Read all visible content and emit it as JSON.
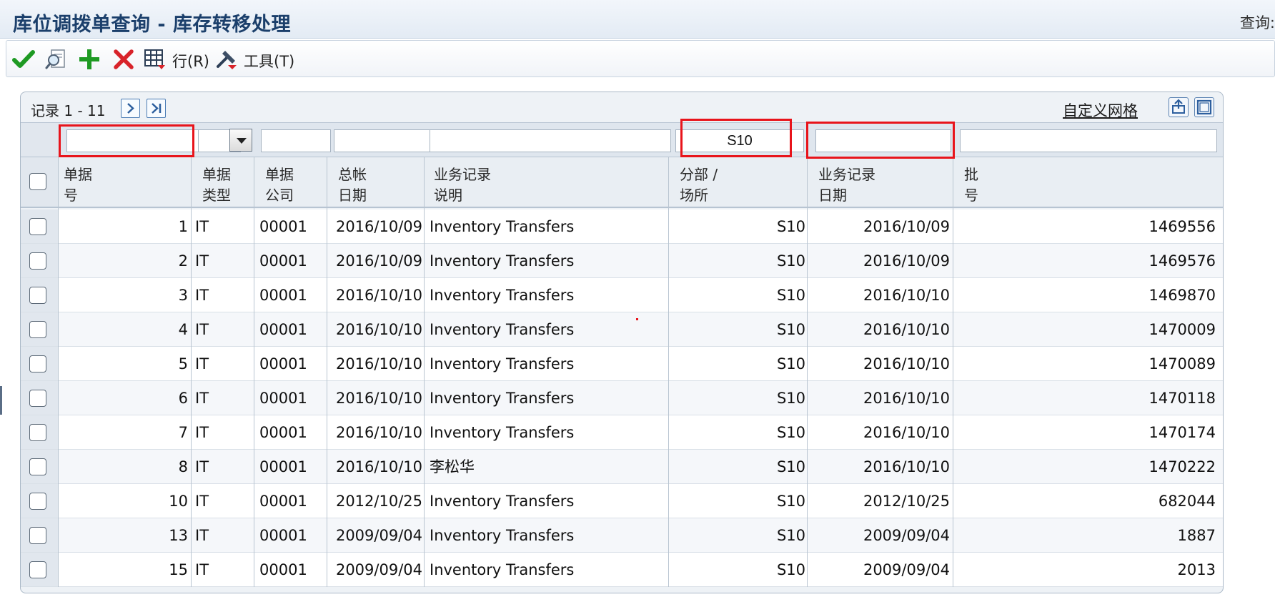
{
  "window": {
    "title": "库位调拨单查询 - 库存转移处理",
    "query_label": "查询:"
  },
  "toolbar": {
    "ok_icon": "checkmark-icon",
    "find_icon": "search-document-icon",
    "add_icon": "plus-icon",
    "delete_icon": "x-icon",
    "row_label": "行(R)",
    "tools_label": "工具(T)"
  },
  "grid": {
    "records_label": "记录 1 - 11",
    "customize_label": "自定义网格",
    "filters": {
      "doc_no": "",
      "doc_type": "",
      "doc_company": "",
      "gl_date": "",
      "explanation": "",
      "branch_plant": "S10",
      "transaction_date": "",
      "lot_no": ""
    },
    "columns": {
      "doc_no": "单据\n号",
      "doc_type": "单据\n类型",
      "doc_company": "单据\n公司",
      "gl_date": "总帐\n日期",
      "explanation": "业务记录\n说明",
      "branch_plant": "分部 /\n场所",
      "transaction_date": "业务记录\n日期",
      "lot_no": "批\n号"
    },
    "rows": [
      {
        "doc_no": "1",
        "doc_type": "IT",
        "company": "00001",
        "gl_date": "2016/10/09",
        "explanation": "Inventory Transfers",
        "branch": "S10",
        "trans_date": "2016/10/09",
        "lot": "1469556"
      },
      {
        "doc_no": "2",
        "doc_type": "IT",
        "company": "00001",
        "gl_date": "2016/10/09",
        "explanation": "Inventory Transfers",
        "branch": "S10",
        "trans_date": "2016/10/09",
        "lot": "1469576"
      },
      {
        "doc_no": "3",
        "doc_type": "IT",
        "company": "00001",
        "gl_date": "2016/10/10",
        "explanation": "Inventory Transfers",
        "branch": "S10",
        "trans_date": "2016/10/10",
        "lot": "1469870"
      },
      {
        "doc_no": "4",
        "doc_type": "IT",
        "company": "00001",
        "gl_date": "2016/10/10",
        "explanation": "Inventory Transfers",
        "branch": "S10",
        "trans_date": "2016/10/10",
        "lot": "1470009"
      },
      {
        "doc_no": "5",
        "doc_type": "IT",
        "company": "00001",
        "gl_date": "2016/10/10",
        "explanation": "Inventory Transfers",
        "branch": "S10",
        "trans_date": "2016/10/10",
        "lot": "1470089"
      },
      {
        "doc_no": "6",
        "doc_type": "IT",
        "company": "00001",
        "gl_date": "2016/10/10",
        "explanation": "Inventory Transfers",
        "branch": "S10",
        "trans_date": "2016/10/10",
        "lot": "1470118"
      },
      {
        "doc_no": "7",
        "doc_type": "IT",
        "company": "00001",
        "gl_date": "2016/10/10",
        "explanation": "Inventory Transfers",
        "branch": "S10",
        "trans_date": "2016/10/10",
        "lot": "1470174"
      },
      {
        "doc_no": "8",
        "doc_type": "IT",
        "company": "00001",
        "gl_date": "2016/10/10",
        "explanation": "李松华",
        "branch": "S10",
        "trans_date": "2016/10/10",
        "lot": "1470222"
      },
      {
        "doc_no": "10",
        "doc_type": "IT",
        "company": "00001",
        "gl_date": "2012/10/25",
        "explanation": "Inventory Transfers",
        "branch": "S10",
        "trans_date": "2012/10/25",
        "lot": "682044"
      },
      {
        "doc_no": "13",
        "doc_type": "IT",
        "company": "00001",
        "gl_date": "2009/09/04",
        "explanation": "Inventory Transfers",
        "branch": "S10",
        "trans_date": "2009/09/04",
        "lot": "1887"
      },
      {
        "doc_no": "15",
        "doc_type": "IT",
        "company": "00001",
        "gl_date": "2009/09/04",
        "explanation": "Inventory Transfers",
        "branch": "S10",
        "trans_date": "2009/09/04",
        "lot": "2013"
      }
    ]
  },
  "colors": {
    "title": "#1b3f6b",
    "highlight": "#e8141b",
    "ok_green": "#1e9a23",
    "delete_red": "#d8232a"
  }
}
